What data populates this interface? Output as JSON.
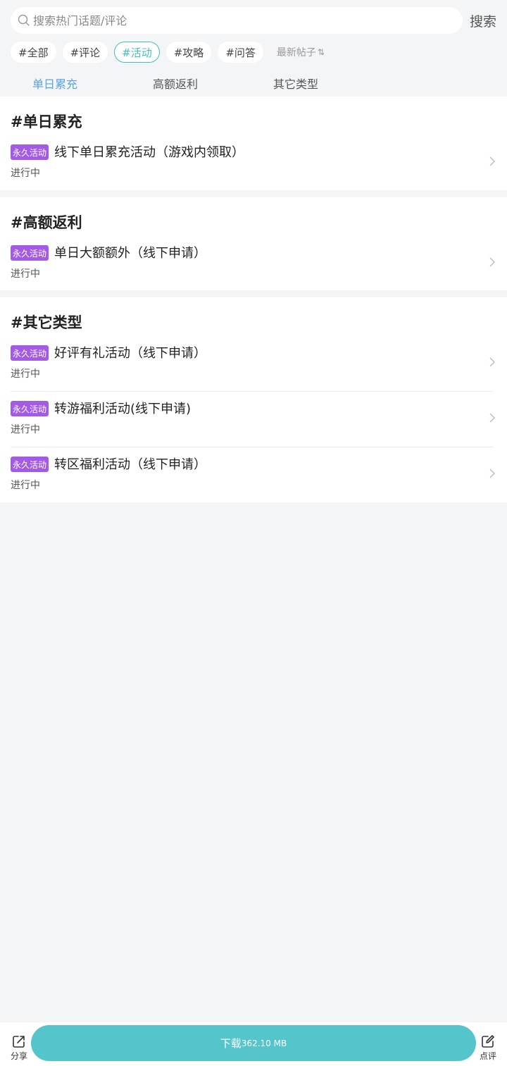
{
  "search": {
    "placeholder": "搜索热门话题/评论",
    "button_label": "搜索"
  },
  "tags": [
    {
      "label": "#全部",
      "active": false
    },
    {
      "label": "#评论",
      "active": false
    },
    {
      "label": "#活动",
      "active": true
    },
    {
      "label": "#攻略",
      "active": false
    },
    {
      "label": "#问答",
      "active": false
    }
  ],
  "sort": {
    "label": "最新帖子",
    "icon": "sort-arrows-icon"
  },
  "sub_tabs": [
    {
      "label": "单日累充",
      "active": true
    },
    {
      "label": "高额返利",
      "active": false
    },
    {
      "label": "其它类型",
      "active": false
    }
  ],
  "sections": [
    {
      "title": "#单日累充",
      "items": [
        {
          "badge": "永久活动",
          "title": "线下单日累充活动（游戏内领取）",
          "status": "进行中"
        }
      ]
    },
    {
      "title": "#高额返利",
      "items": [
        {
          "badge": "永久活动",
          "title": "单日大额额外（线下申请）",
          "status": "进行中"
        }
      ]
    },
    {
      "title": "#其它类型",
      "items": [
        {
          "badge": "永久活动",
          "title": "好评有礼活动（线下申请）",
          "status": "进行中"
        },
        {
          "badge": "永久活动",
          "title": "转游福利活动(线下申请)",
          "status": "进行中"
        },
        {
          "badge": "永久活动",
          "title": "转区福利活动（线下申请）",
          "status": "进行中"
        }
      ]
    }
  ],
  "bottom_bar": {
    "share_label": "分享",
    "download_label": "下载",
    "download_size": "362.10 MB",
    "review_label": "点评"
  },
  "colors": {
    "accent": "#54c5cb",
    "active_tag": "#45bcc0",
    "active_tab": "#5aa3dc",
    "badge": "#a35be6"
  }
}
